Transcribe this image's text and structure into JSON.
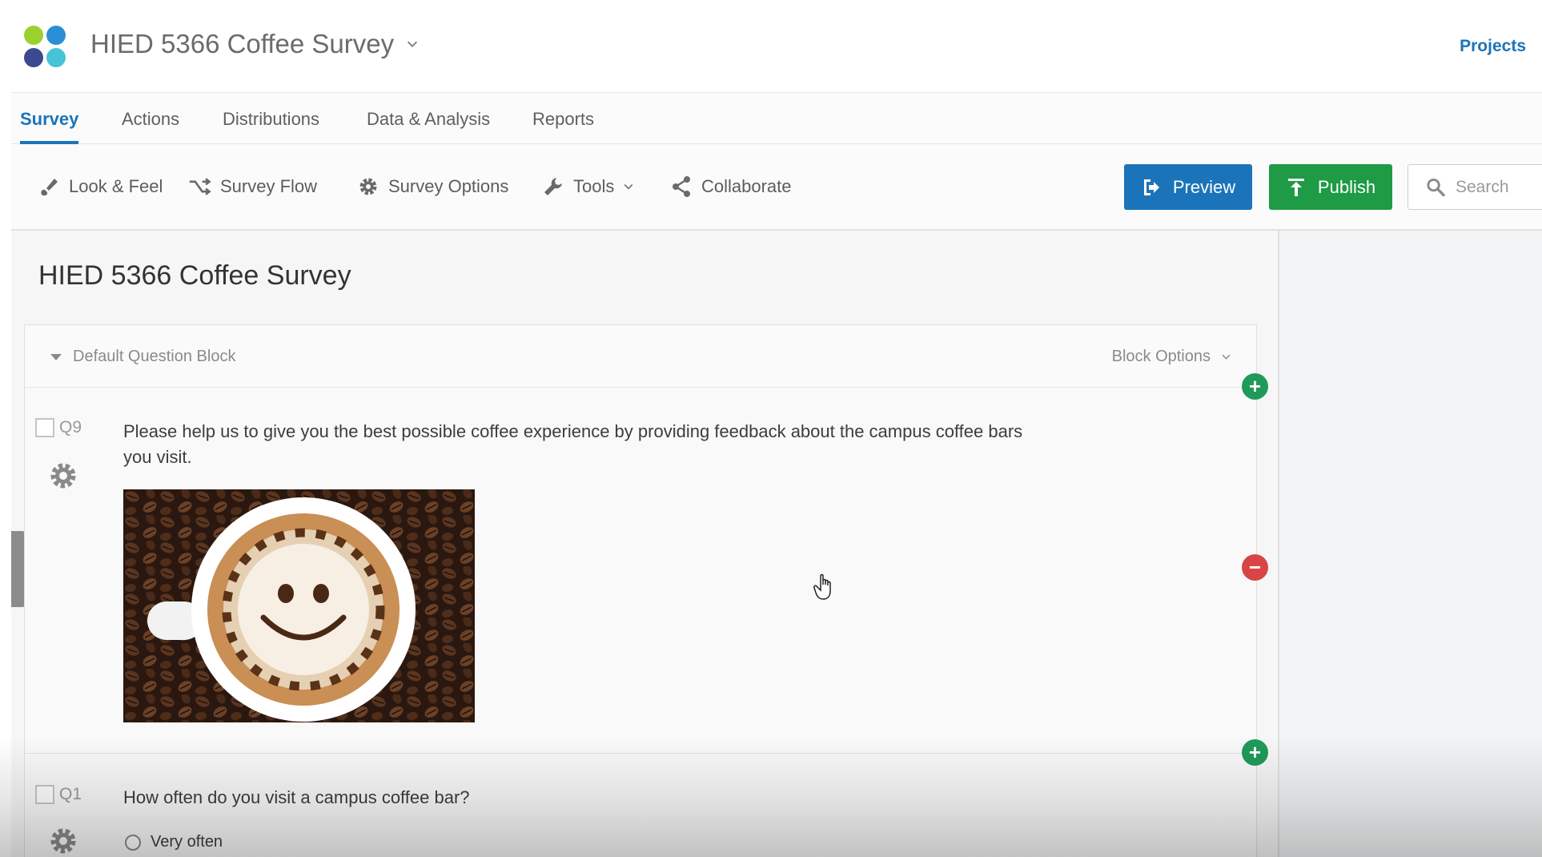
{
  "header": {
    "survey_name": "HIED 5366 Coffee Survey",
    "projects_label": "Projects"
  },
  "logo": {
    "colors": [
      "#9bd12f",
      "#2a8fd6",
      "#3b4a8f",
      "#46c3d6"
    ]
  },
  "tabs": [
    {
      "label": "Survey",
      "active": true
    },
    {
      "label": "Actions",
      "active": false
    },
    {
      "label": "Distributions",
      "active": false
    },
    {
      "label": "Data & Analysis",
      "active": false
    },
    {
      "label": "Reports",
      "active": false
    }
  ],
  "toolbar": {
    "look_feel": "Look & Feel",
    "survey_flow": "Survey Flow",
    "survey_options": "Survey Options",
    "tools": "Tools",
    "collaborate": "Collaborate",
    "preview": "Preview",
    "publish": "Publish",
    "search_placeholder": "Search"
  },
  "survey_title": "HIED 5366 Coffee Survey",
  "block": {
    "name": "Default Question Block",
    "options_label": "Block Options"
  },
  "questions": [
    {
      "number": "Q9",
      "text": "Please help us to give you the best possible coffee experience by providing feedback about the campus coffee bars you visit."
    },
    {
      "number": "Q1",
      "text": "How often do you visit a campus coffee bar?",
      "choices": [
        "Very often"
      ]
    }
  ],
  "colors": {
    "accent_blue": "#1b74b9",
    "publish_green": "#1f9a45",
    "add_green": "#1f9a5a",
    "remove_red": "#d94545"
  },
  "icons": {
    "look_feel": "paint-brush-icon",
    "survey_flow": "flow-arrows-icon",
    "survey_options": "gear-icon",
    "tools": "wrench-icon",
    "collaborate": "share-icon",
    "preview": "preview-icon",
    "publish": "upload-arrow-icon",
    "search": "search-icon"
  }
}
